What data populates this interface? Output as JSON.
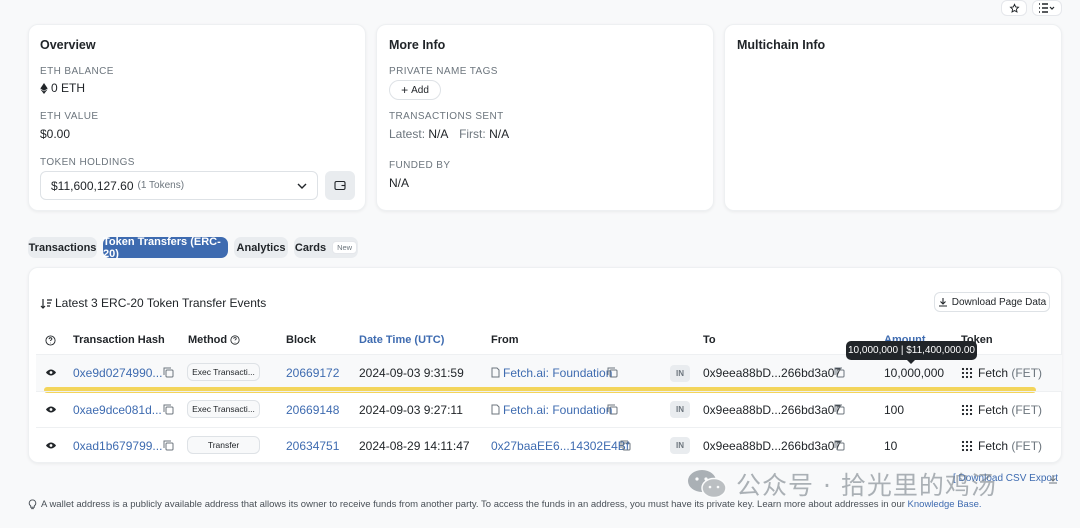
{
  "overview": {
    "title": "Overview",
    "eth_balance_label": "ETH BALANCE",
    "eth_balance_value": "0 ETH",
    "eth_value_label": "ETH VALUE",
    "eth_value_value": "$0.00",
    "token_holdings_label": "TOKEN HOLDINGS",
    "token_holdings_value": "$11,600,127.60",
    "token_holdings_count": "(1 Tokens)"
  },
  "more_info": {
    "title": "More Info",
    "private_tags_label": "PRIVATE NAME TAGS",
    "add_label": "Add",
    "tx_sent_label": "TRANSACTIONS SENT",
    "latest_label": "Latest:",
    "latest_value": "N/A",
    "first_label": "First:",
    "first_value": "N/A",
    "funded_by_label": "FUNDED BY",
    "funded_by_value": "N/A"
  },
  "multichain": {
    "title": "Multichain Info"
  },
  "tabs": [
    {
      "label": "Transactions",
      "active": false
    },
    {
      "label": "Token Transfers (ERC-20)",
      "active": true
    },
    {
      "label": "Analytics",
      "active": false
    },
    {
      "label": "Cards",
      "active": false,
      "badge": "New"
    }
  ],
  "table": {
    "heading": "Latest 3 ERC-20 Token Transfer Events",
    "download_label": "Download Page Data",
    "columns": {
      "hash": "Transaction Hash",
      "method": "Method",
      "block": "Block",
      "datetime": "Date Time (UTC)",
      "from": "From",
      "to": "To",
      "amount": "Amount",
      "token": "Token"
    },
    "tooltip": "10,000,000 | $11,400,000.00",
    "rows": [
      {
        "hash": "0xe9d0274990...",
        "method": "Exec Transacti...",
        "block": "20669172",
        "datetime": "2024-09-03 9:31:59",
        "from": "Fetch.ai: Foundation",
        "dir": "IN",
        "to": "0x9eea88bD...266bd3a07",
        "amount": "10,000,000",
        "token": "Fetch",
        "symbol": "(FET)"
      },
      {
        "hash": "0xae9dce081d...",
        "method": "Exec Transacti...",
        "block": "20669148",
        "datetime": "2024-09-03 9:27:11",
        "from": "Fetch.ai: Foundation",
        "dir": "IN",
        "to": "0x9eea88bD...266bd3a07",
        "amount": "100",
        "token": "Fetch",
        "symbol": "(FET)"
      },
      {
        "hash": "0xad1b679799...",
        "method": "Transfer",
        "block": "20634751",
        "datetime": "2024-08-29 14:11:47",
        "from": "0x27baaEE6...14302E4Bf",
        "dir": "IN",
        "to": "0x9eea88bD...266bd3a07",
        "amount": "10",
        "token": "Fetch",
        "symbol": "(FET)"
      }
    ],
    "footer_links": "[ Download CSV Export"
  },
  "footer": {
    "note": "A wallet address is a publicly available address that allows its owner to receive funds from another party. To access the funds in an address, you must have its private key. Learn more about addresses in our",
    "kb_link": "Knowledge Base."
  },
  "watermark": "公众号 · 拾光里的鸡汤",
  "colors": {
    "accent": "#3e6bb0",
    "highlight": "#f3d55b"
  }
}
